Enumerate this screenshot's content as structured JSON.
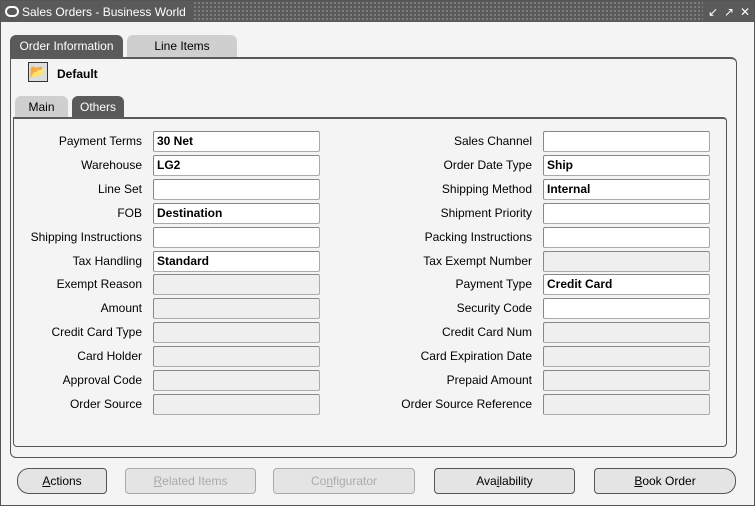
{
  "window": {
    "title": "Sales Orders - Business World",
    "controls": [
      "minimize-icon",
      "maximize-icon",
      "close-icon"
    ]
  },
  "outer_tabs": [
    {
      "label": "Order Information",
      "active": true
    },
    {
      "label": "Line Items",
      "active": false
    }
  ],
  "default_folder": {
    "icon": "open-folder-icon",
    "label": "Default"
  },
  "inner_tabs": [
    {
      "label": "Main",
      "active": false
    },
    {
      "label": "Others",
      "active": true
    }
  ],
  "left_fields": [
    {
      "label": "Payment Terms",
      "value": "30 Net",
      "enabled": true
    },
    {
      "label": "Warehouse",
      "value": "LG2",
      "enabled": true
    },
    {
      "label": "Line Set",
      "value": "",
      "enabled": true
    },
    {
      "label": "FOB",
      "value": "Destination",
      "enabled": true
    },
    {
      "label": "Shipping Instructions",
      "value": "",
      "enabled": true
    },
    {
      "label": "Tax Handling",
      "value": "Standard",
      "enabled": true
    },
    {
      "label": "Exempt Reason",
      "value": "",
      "enabled": false
    },
    {
      "label": "Amount",
      "value": "",
      "enabled": false
    },
    {
      "label": "Credit Card Type",
      "value": "",
      "enabled": false
    },
    {
      "label": "Card Holder",
      "value": "",
      "enabled": false
    },
    {
      "label": "Approval Code",
      "value": "",
      "enabled": false
    },
    {
      "label": "Order Source",
      "value": "",
      "enabled": false
    }
  ],
  "right_fields": [
    {
      "label": "Sales Channel",
      "value": "",
      "enabled": true
    },
    {
      "label": "Order Date Type",
      "value": "Ship",
      "enabled": true
    },
    {
      "label": "Shipping Method",
      "value": "Internal",
      "enabled": true
    },
    {
      "label": "Shipment Priority",
      "value": "",
      "enabled": true
    },
    {
      "label": "Packing Instructions",
      "value": "",
      "enabled": true
    },
    {
      "label": "Tax Exempt Number",
      "value": "",
      "enabled": false
    },
    {
      "label": "Payment Type",
      "value": "Credit Card",
      "enabled": true
    },
    {
      "label": "Security Code",
      "value": "",
      "enabled": true
    },
    {
      "label": "Credit Card Num",
      "value": "",
      "enabled": false
    },
    {
      "label": "Card Expiration Date",
      "value": "",
      "enabled": false
    },
    {
      "label": "Prepaid Amount",
      "value": "",
      "enabled": false
    },
    {
      "label": "Order Source Reference",
      "value": "",
      "enabled": false
    }
  ],
  "buttons": [
    {
      "label": "Actions",
      "mnemonic": "A",
      "enabled": true
    },
    {
      "label": "Related Items",
      "mnemonic": "R",
      "enabled": false
    },
    {
      "label": "Configurator",
      "mnemonic": "n",
      "enabled": false
    },
    {
      "label": "Availability",
      "mnemonic": "i",
      "enabled": true
    },
    {
      "label": "Book Order",
      "mnemonic": "B",
      "enabled": true
    }
  ]
}
